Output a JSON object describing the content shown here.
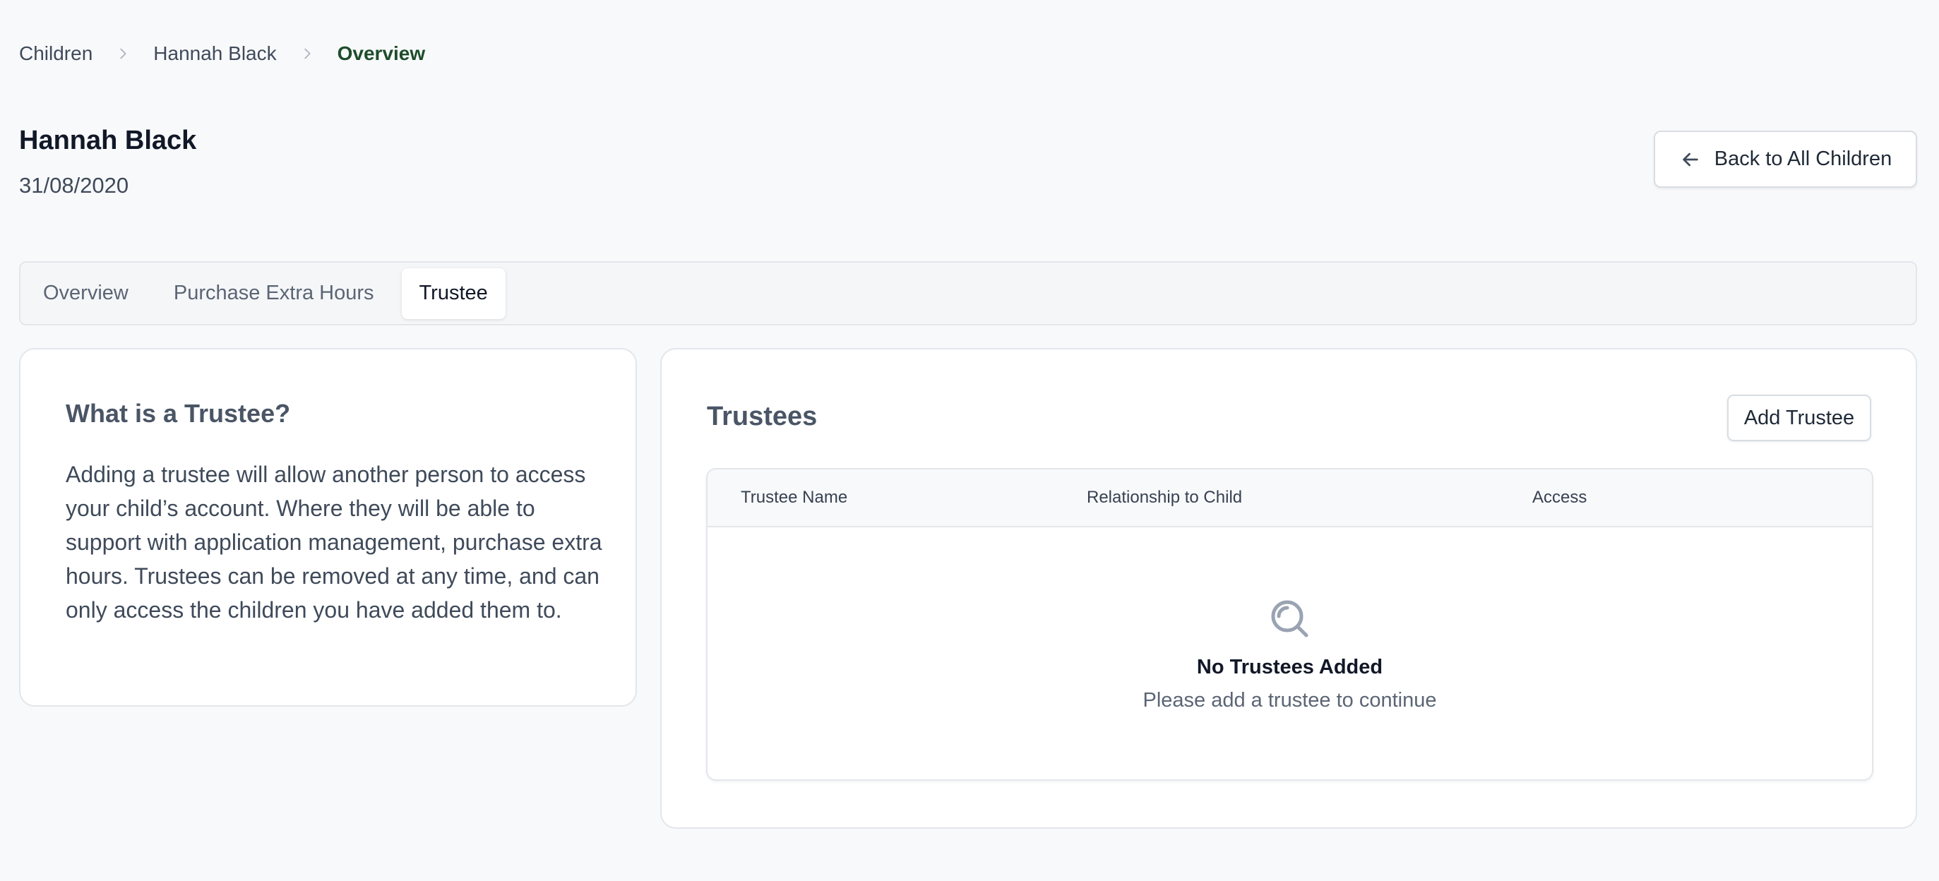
{
  "breadcrumb": {
    "items": [
      "Children",
      "Hannah Black",
      "Overview"
    ]
  },
  "header": {
    "title": "Hannah Black",
    "subtitle": "31/08/2020",
    "back_label": "Back to All Children"
  },
  "tabs": [
    {
      "label": "Overview"
    },
    {
      "label": "Purchase Extra Hours"
    },
    {
      "label": "Trustee",
      "active": true
    }
  ],
  "info": {
    "title": "What is a Trustee?",
    "body": "Adding a trustee will allow another person to access your child’s account. Where they will be able to support with application management, purchase extra hours. Trustees can be removed at any time, and can only access the children you have added them to."
  },
  "trustees": {
    "title": "Trustees",
    "add_label": "Add Trustee",
    "columns": [
      "Trustee Name",
      "Relationship to Child",
      "Access"
    ],
    "rows": [],
    "empty_title": "No Trustees Added",
    "empty_text": "Please add a trustee to continue"
  },
  "icons": {
    "breadcrumb_separator": "chevron-right-icon",
    "back": "arrow-left-icon",
    "empty": "search-icon"
  },
  "colors": {
    "background": "#f8f9fb",
    "breadcrumb_current": "#1e4d2b",
    "border": "#e3e6eb"
  }
}
